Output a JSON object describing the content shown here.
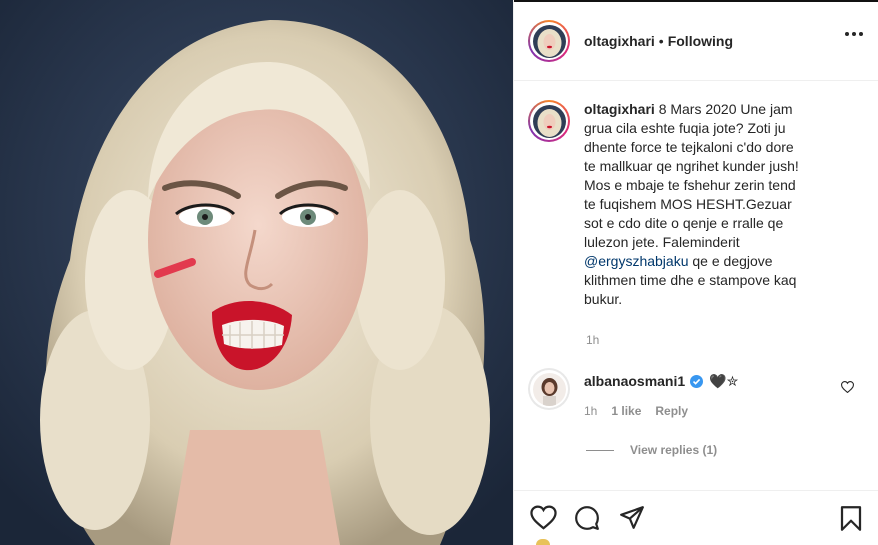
{
  "post": {
    "author": "oltagixhari",
    "separator": "•",
    "follow_status": "Following",
    "caption": {
      "author": "oltagixhari",
      "date": "8 Mars 2020",
      "text_before_mention": "Une jam grua cila eshte fuqia jote? Zoti ju dhente force te tejkaloni c'do dore te mallkuar qe ngrihet kunder jush! Mos e mbaje te fshehur zerin tend te fuqishem MOS HESHT.Gezuar sot e cdo dite o qenje e rralle qe lulezon jete. Faleminderit",
      "mention": "@ergyszhabjaku",
      "text_after_mention": " qe e degjove klithmen time dhe e stampove kaq bukur.",
      "time": "1h"
    },
    "comments": [
      {
        "author": "albanaosmani1",
        "verified": true,
        "text": "🖤✮",
        "time": "1h",
        "likes": "1 like",
        "reply_label": "Reply"
      }
    ],
    "view_replies": "View replies (1)"
  },
  "icons": {
    "more": "more-horizontal-icon",
    "like": "heart-icon",
    "comment": "comment-icon",
    "share": "paper-plane-icon",
    "save": "bookmark-icon",
    "verified": "verified-badge-icon"
  },
  "colors": {
    "accent_link": "#00376b",
    "verified_blue": "#3897f0",
    "muted": "#8e8e8e",
    "text": "#262626"
  }
}
